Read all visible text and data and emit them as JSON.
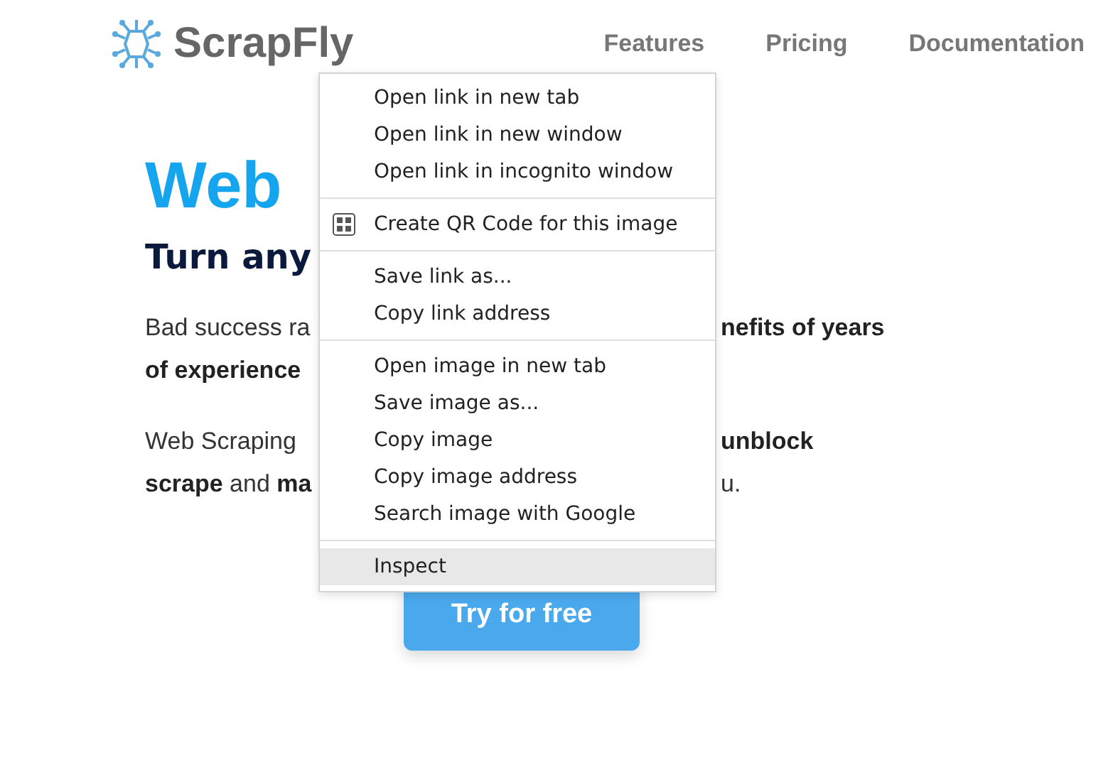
{
  "header": {
    "logo_text": "ScrapFly",
    "nav": [
      {
        "label": "Features"
      },
      {
        "label": "Pricing"
      },
      {
        "label": "Documentation"
      }
    ]
  },
  "hero": {
    "title": "Web",
    "subtitle": "Turn any",
    "paragraphs": [
      {
        "left": [
          "Bad success ra",
          "**of experience**"
        ],
        "right": [
          "**nefits of years**"
        ]
      },
      {
        "left": [
          "Web Scraping",
          "**scrape** and **ma**"
        ],
        "right": [
          "**unblock**",
          "u."
        ]
      }
    ],
    "cta": "Try for free"
  },
  "context_menu": {
    "groups": [
      [
        {
          "kind": "text",
          "label": "Open link in new tab",
          "highlighted": false
        },
        {
          "kind": "text",
          "label": "Open link in new window",
          "highlighted": false
        },
        {
          "kind": "text",
          "label": "Open link in incognito window",
          "highlighted": false
        }
      ],
      [
        {
          "kind": "qr",
          "label": "Create QR Code for this image",
          "highlighted": false
        }
      ],
      [
        {
          "kind": "text",
          "label": "Save link as...",
          "highlighted": false
        },
        {
          "kind": "text",
          "label": "Copy link address",
          "highlighted": false
        }
      ],
      [
        {
          "kind": "text",
          "label": "Open image in new tab",
          "highlighted": false
        },
        {
          "kind": "text",
          "label": "Save image as...",
          "highlighted": false
        },
        {
          "kind": "text",
          "label": "Copy image",
          "highlighted": false
        },
        {
          "kind": "text",
          "label": "Copy image address",
          "highlighted": false
        },
        {
          "kind": "text",
          "label": "Search image with Google",
          "highlighted": false
        }
      ],
      [
        {
          "kind": "text",
          "label": "Inspect",
          "highlighted": true
        }
      ]
    ]
  }
}
